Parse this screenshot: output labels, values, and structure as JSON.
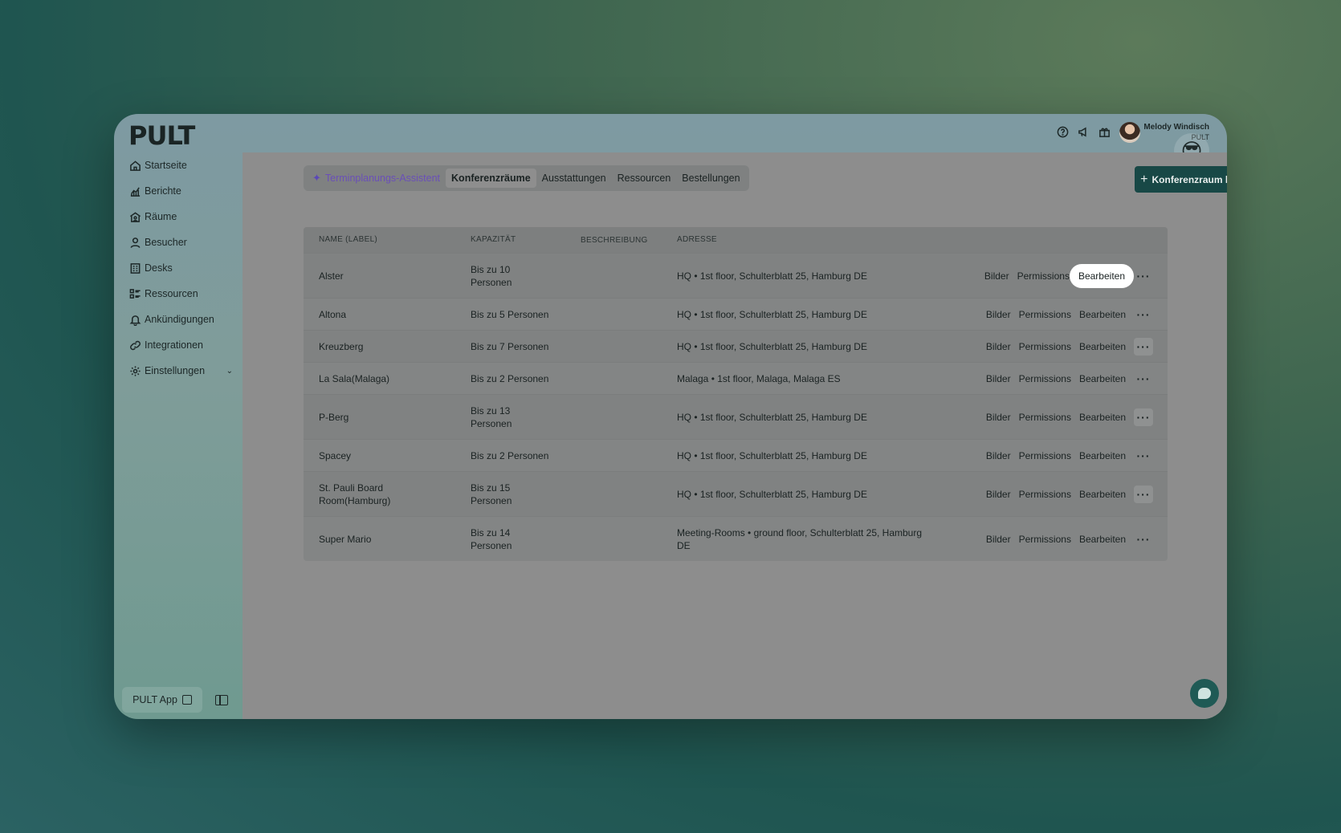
{
  "app": {
    "logo": "PULT"
  },
  "sidebar": {
    "items": [
      {
        "label": "Startseite",
        "icon": "home-icon"
      },
      {
        "label": "Berichte",
        "icon": "chart-icon"
      },
      {
        "label": "Räume",
        "icon": "rooms-icon"
      },
      {
        "label": "Besucher",
        "icon": "user-icon"
      },
      {
        "label": "Desks",
        "icon": "desk-icon"
      },
      {
        "label": "Ressourcen",
        "icon": "resources-icon"
      },
      {
        "label": "Ankündigungen",
        "icon": "bell-icon"
      },
      {
        "label": "Integrationen",
        "icon": "link-icon"
      },
      {
        "label": "Einstellungen",
        "icon": "gear-icon"
      }
    ],
    "app_button": "PULT App"
  },
  "topbar": {
    "user_name": "Melody Windisch",
    "user_sub": "PULT",
    "emoji": "😎"
  },
  "tabs": {
    "assistant": "Terminplanungs-Assistent",
    "items": [
      "Konferenzräume",
      "Ausstattungen",
      "Ressourcen",
      "Bestellungen"
    ],
    "active": "Konferenzräume"
  },
  "add_button": "Konferenzraum hinzufügen",
  "table": {
    "headers": [
      "NAME (LABEL)",
      "KAPAZITÄT",
      "BESCHREIBUNG",
      "ADRESSE"
    ],
    "actions": {
      "images": "Bilder",
      "permissions": "Permissions",
      "edit": "Bearbeiten"
    },
    "rows": [
      {
        "name": "Alster",
        "capacity": "Bis zu 10\nPersonen",
        "address": "HQ • 1st floor, Schulterblatt 25, Hamburg DE"
      },
      {
        "name": "Altona",
        "capacity": "Bis zu 5 Personen",
        "address": "HQ • 1st floor, Schulterblatt 25, Hamburg DE"
      },
      {
        "name": "Kreuzberg",
        "capacity": "Bis zu 7 Personen",
        "address": "HQ • 1st floor, Schulterblatt 25, Hamburg DE"
      },
      {
        "name": "La Sala(Malaga)",
        "capacity": "Bis zu 2 Personen",
        "address": "Malaga • 1st floor, Malaga, Malaga ES"
      },
      {
        "name": "P-Berg",
        "capacity": "Bis zu 13\nPersonen",
        "address": "HQ • 1st floor, Schulterblatt 25, Hamburg DE"
      },
      {
        "name": "Spacey",
        "capacity": "Bis zu 2 Personen",
        "address": "HQ • 1st floor, Schulterblatt 25, Hamburg DE"
      },
      {
        "name": "St. Pauli Board\nRoom(Hamburg)",
        "capacity": "Bis zu 15\nPersonen",
        "address": "HQ • 1st floor, Schulterblatt 25, Hamburg DE"
      },
      {
        "name": "Super Mario",
        "capacity": "Bis zu 14\nPersonen",
        "address": "Meeting-Rooms • ground floor, Schulterblatt 25, Hamburg\nDE"
      }
    ]
  }
}
